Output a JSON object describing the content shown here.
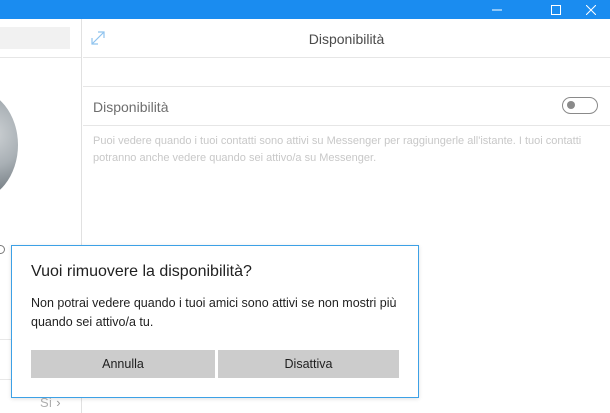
{
  "window": {
    "titlebar_color": "#1a8cf0",
    "controls": [
      "minimize-icon",
      "maximize-icon",
      "close-icon"
    ]
  },
  "left_pane": {
    "footer_link": "Sì",
    "footer_chevron": "›"
  },
  "main": {
    "title": "Disponibilità",
    "expand_icon": "expand-icon",
    "setting": {
      "label": "Disponibilità",
      "toggle_on": false,
      "description": "Puoi vedere quando i tuoi contatti sono attivi su Messenger per raggiungerle all'istante. I tuoi contatti potranno anche vedere quando sei attivo/a su Messenger."
    }
  },
  "dialog": {
    "title": "Vuoi rimuovere la disponibilità?",
    "message": "Non potrai vedere quando i tuoi amici sono attivi se non mostri più quando sei attivo/a tu.",
    "cancel_label": "Annulla",
    "confirm_label": "Disattiva",
    "border_color": "#3da1e6"
  }
}
